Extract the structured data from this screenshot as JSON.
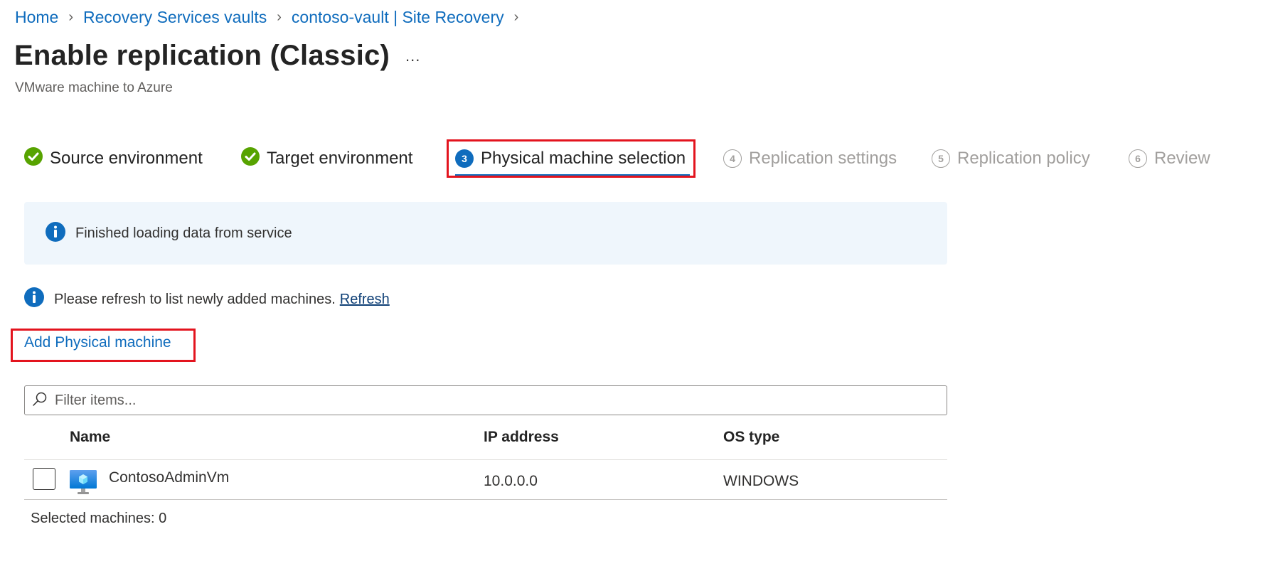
{
  "breadcrumb": [
    {
      "label": "Home"
    },
    {
      "label": "Recovery Services vaults"
    },
    {
      "label": "contoso-vault | Site Recovery"
    }
  ],
  "header": {
    "title": "Enable replication (Classic)",
    "more_label": "...",
    "subtitle": "VMware machine to Azure"
  },
  "steps": [
    {
      "number": "1",
      "label": "Source environment",
      "state": "completed"
    },
    {
      "number": "2",
      "label": "Target environment",
      "state": "completed"
    },
    {
      "number": "3",
      "label": "Physical machine selection",
      "state": "active"
    },
    {
      "number": "4",
      "label": "Replication settings",
      "state": "pending"
    },
    {
      "number": "5",
      "label": "Replication policy",
      "state": "pending"
    },
    {
      "number": "6",
      "label": "Review",
      "state": "pending"
    }
  ],
  "banner": {
    "icon": "info-icon",
    "text": "Finished loading data from service"
  },
  "refresh_notice": {
    "icon": "info-icon",
    "text": "Please refresh to list newly added machines.",
    "link_label": "Refresh"
  },
  "add_machine_label": "Add Physical machine",
  "filter": {
    "placeholder": "Filter items...",
    "value": ""
  },
  "table": {
    "columns": [
      "Name",
      "IP address",
      "OS type"
    ],
    "rows": [
      {
        "selected": false,
        "icon": "virtual-machine-icon",
        "name": "ContosoAdminVm",
        "ip": "10.0.0.0",
        "os": "WINDOWS"
      }
    ]
  },
  "selected_summary": "Selected machines: 0",
  "colors": {
    "link": "#0f6cbd",
    "success": "#57a300",
    "highlight_box": "#e3141e",
    "banner_bg": "#eff6fc",
    "pending": "#a19f9d"
  }
}
